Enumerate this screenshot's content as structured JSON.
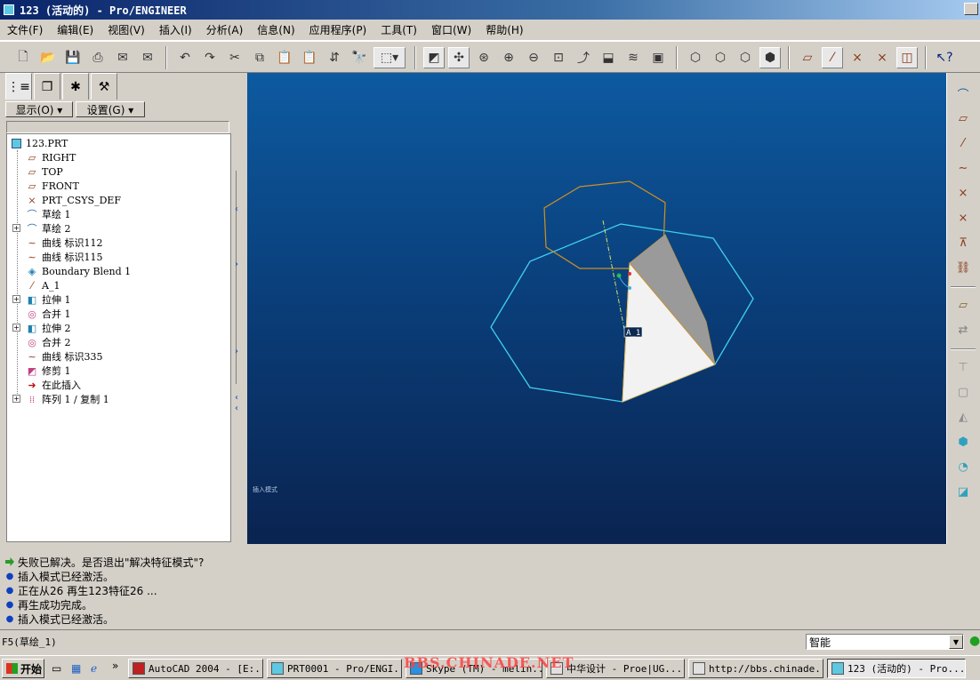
{
  "window": {
    "title": "123 (活动的) - Pro/ENGINEER"
  },
  "menubar": {
    "items": [
      "文件(F)",
      "编辑(E)",
      "视图(V)",
      "插入(I)",
      "分析(A)",
      "信息(N)",
      "应用程序(P)",
      "工具(T)",
      "窗口(W)",
      "帮助(H)"
    ]
  },
  "panel": {
    "show_button": "显示(O) ▾",
    "settings_button": "设置(G) ▾"
  },
  "tree": {
    "items": [
      {
        "label": "123.PRT",
        "icon": "part-icon"
      },
      {
        "label": "RIGHT",
        "icon": "datum-plane-icon"
      },
      {
        "label": "TOP",
        "icon": "datum-plane-icon"
      },
      {
        "label": "FRONT",
        "icon": "datum-plane-icon"
      },
      {
        "label": "PRT_CSYS_DEF",
        "icon": "coordinate-system-icon"
      },
      {
        "label": "草绘 1",
        "icon": "sketch-icon"
      },
      {
        "label": "草绘 2",
        "icon": "sketch-icon"
      },
      {
        "label": "曲线 标识112",
        "icon": "curve-icon"
      },
      {
        "label": "曲线 标识115",
        "icon": "curve-icon"
      },
      {
        "label": "Boundary Blend 1",
        "icon": "boundary-blend-icon"
      },
      {
        "label": "A_1",
        "icon": "datum-axis-icon"
      },
      {
        "label": "拉伸 1",
        "icon": "extrude-icon"
      },
      {
        "label": "合并 1",
        "icon": "merge-icon"
      },
      {
        "label": "拉伸 2",
        "icon": "extrude-icon"
      },
      {
        "label": "合并 2",
        "icon": "merge-icon"
      },
      {
        "label": "曲线 标识335",
        "icon": "curve-icon"
      },
      {
        "label": "修剪 1",
        "icon": "trim-icon"
      },
      {
        "label": "在此插入",
        "icon": "insert-here-arrow-icon"
      },
      {
        "label": "阵列 1 / 复制 1",
        "icon": "pattern-icon"
      }
    ]
  },
  "graphics": {
    "axis_label": "A_1",
    "hint": "插入模式"
  },
  "messages": [
    {
      "type": "prompt",
      "text": "失败已解决。是否退出\"解决特征模式\"?"
    },
    {
      "type": "info",
      "text": "插入模式已经激活。"
    },
    {
      "type": "info",
      "text": "正在从26 再生123特征26 ..."
    },
    {
      "type": "info",
      "text": "再生成功完成。"
    },
    {
      "type": "info",
      "text": "插入模式已经激活。"
    }
  ],
  "statusbar": {
    "left_text": "F5(草绘_1)",
    "filter_value": "智能"
  },
  "taskbar": {
    "start_label": "开始",
    "watermark": "BBS.CHINADE.NET",
    "tasks": [
      "AutoCAD 2004 - [E:...",
      "PRT0001 - Pro/ENGI...",
      "Skype (TM) - melin...",
      "中华设计 - Proe|UG...",
      "http://bbs.chinade...",
      "123 (活动的) - Pro..."
    ]
  },
  "colors": {
    "titlebar": "#0a246a",
    "viewport_top": "#0d5aa0",
    "viewport_bottom": "#0a2350",
    "sketch_cyan": "#40d0f0",
    "sketch_orange": "#d09020"
  }
}
